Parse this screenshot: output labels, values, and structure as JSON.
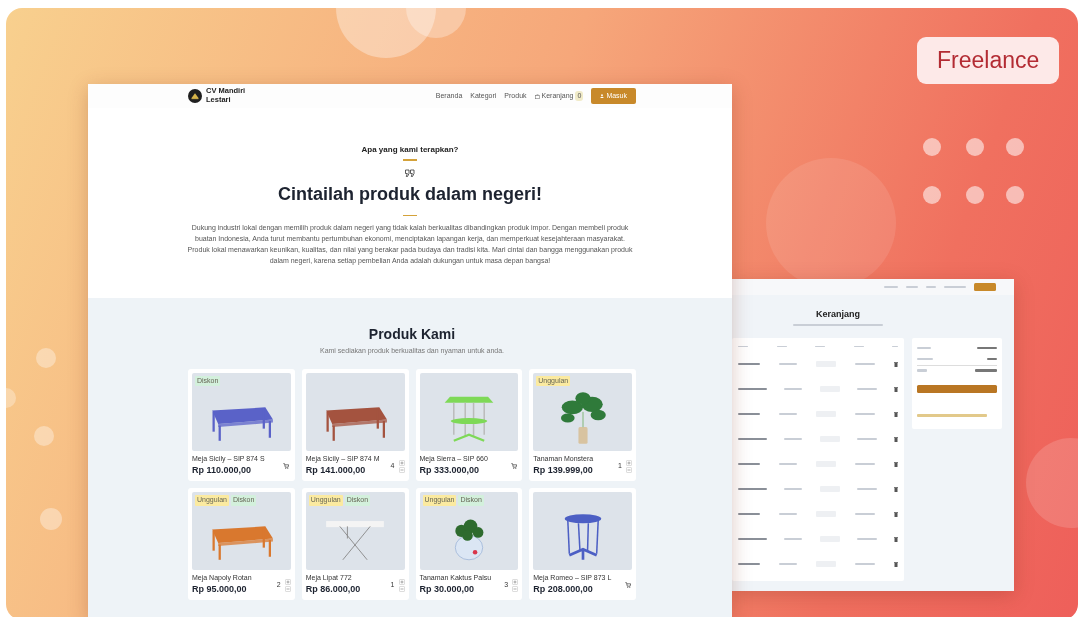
{
  "badge": "Freelance",
  "main_window": {
    "brand": "CV Mandiri Lestari",
    "nav": [
      {
        "label": "Beranda"
      },
      {
        "label": "Kategori"
      },
      {
        "label": "Produk"
      }
    ],
    "cart_link": {
      "label": "Keranjang",
      "count": "0"
    },
    "login_button": "Masuk",
    "hero": {
      "eyebrow": "Apa yang kami terapkan?",
      "title": "Cintailah produk dalam negeri!",
      "body": "Dukung industri lokal dengan memilih produk dalam negeri yang tidak kalah berkualitas dibandingkan produk impor. Dengan membeli produk buatan Indonesia, Anda turut membantu pertumbuhan ekonomi, menciptakan lapangan kerja, dan memperkuat kesejahteraan masyarakat. Produk lokal menawarkan keunikan, kualitas, dan nilai yang berakar pada budaya dan tradisi kita. Mari cintai dan bangga menggunakan produk dalam negeri, karena setiap pembelian Anda adalah dukungan untuk masa depan bangsa!"
    },
    "products": {
      "title": "Produk Kami",
      "subtitle": "Kami sediakan produk berkualitas dan nyaman untuk anda.",
      "items": [
        {
          "name": "Meja Sicily – SIP 874 S",
          "price": "Rp 110.000,00",
          "badges": [
            {
              "label": "Diskon",
              "color": "#d3f0dc"
            }
          ],
          "image": {
            "kind": "table",
            "color": "#5a62c8"
          },
          "action": {
            "kind": "add"
          }
        },
        {
          "name": "Meja Sicily – SIP 874 M",
          "price": "Rp 141.000,00",
          "image": {
            "kind": "table",
            "color": "#a4533f"
          },
          "action": {
            "kind": "stepper",
            "qty": "4"
          }
        },
        {
          "name": "Meja Sierra – SIP 660",
          "price": "Rp 333.000,00",
          "image": {
            "kind": "shelf-table",
            "color": "#7ed957"
          },
          "action": {
            "kind": "add"
          }
        },
        {
          "name": "Tanaman Monstera",
          "price": "Rp 139.999,00",
          "badges": [
            {
              "label": "Unggulan",
              "color": "#fbeaa0"
            }
          ],
          "image": {
            "kind": "plant",
            "color": "#2f7a3a"
          },
          "action": {
            "kind": "stepper",
            "qty": "1"
          }
        },
        {
          "name": "Meja Napoly Rotan",
          "price": "Rp 95.000,00",
          "badges": [
            {
              "label": "Unggulan",
              "color": "#fbeaa0"
            },
            {
              "label": "Diskon",
              "color": "#d3f0dc"
            }
          ],
          "image": {
            "kind": "table",
            "color": "#d9782e"
          },
          "action": {
            "kind": "stepper",
            "qty": "2"
          }
        },
        {
          "name": "Meja Lipat 772",
          "price": "Rp 86.000,00",
          "badges": [
            {
              "label": "Unggulan",
              "color": "#fbeaa0"
            },
            {
              "label": "Diskon",
              "color": "#d3f0dc"
            }
          ],
          "image": {
            "kind": "folding-table",
            "color": "#f4f4f4"
          },
          "action": {
            "kind": "stepper",
            "qty": "1"
          }
        },
        {
          "name": "Tanaman Kaktus Palsu",
          "price": "Rp 30.000,00",
          "badges": [
            {
              "label": "Unggulan",
              "color": "#fbeaa0"
            },
            {
              "label": "Diskon",
              "color": "#d3f0dc"
            }
          ],
          "image": {
            "kind": "potted-plant",
            "color": "#2e6b2e"
          },
          "action": {
            "kind": "stepper",
            "qty": "3"
          }
        },
        {
          "name": "Meja Romeo – SIP 873 L",
          "price": "Rp 208.000,00",
          "image": {
            "kind": "round-stool",
            "color": "#4c5fc4"
          },
          "action": {
            "kind": "add"
          }
        }
      ]
    }
  },
  "cart_window": {
    "title": "Keranjang"
  }
}
